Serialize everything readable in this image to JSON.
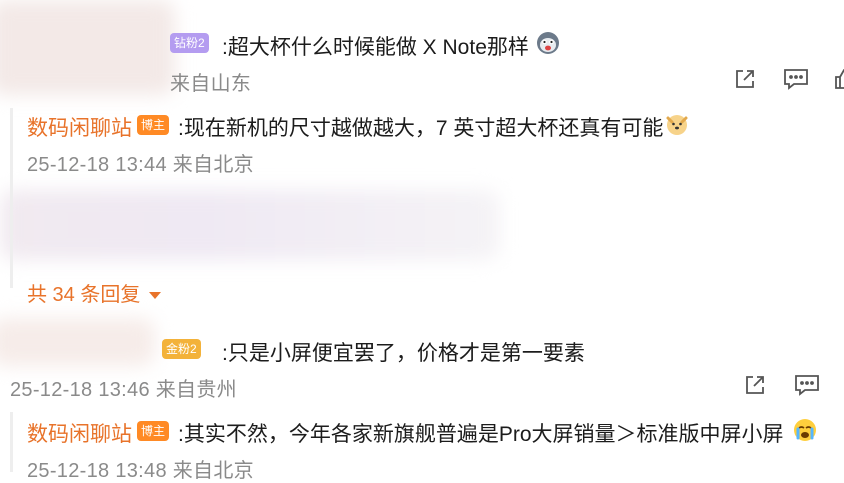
{
  "comment1": {
    "badge": "钻粉2",
    "text": ":超大杯什么时候能做 X Note那样",
    "meta": "来自山东"
  },
  "reply1": {
    "author": "数码闲聊站",
    "badge": "博主",
    "text": ":现在新机的尺寸越做越大，7 英寸超大杯还真有可能",
    "meta": "25-12-18 13:44 来自北京"
  },
  "more_replies": "共 34 条回复",
  "comment2": {
    "badge": "金粉2",
    "text": ":只是小屏便宜罢了，价格才是第一要素",
    "meta": "25-12-18 13:46 来自贵州"
  },
  "reply2": {
    "author": "数码闲聊站",
    "badge": "博主",
    "text": ":其实不然，今年各家新旗舰普遍是Pro大屏销量＞标准版中屏小屏",
    "meta": "25-12-18 13:48 来自北京"
  },
  "colors": {
    "accent": "#e8732a",
    "blogger_badge": "#ff8a25",
    "diamond_badge": "#b49cf0",
    "gold_badge": "#f3b23a"
  },
  "icons": [
    "share-icon",
    "comment-icon",
    "like-icon",
    "dog-emoji-icon",
    "crying-emoji-icon",
    "husky-emoji-icon"
  ]
}
